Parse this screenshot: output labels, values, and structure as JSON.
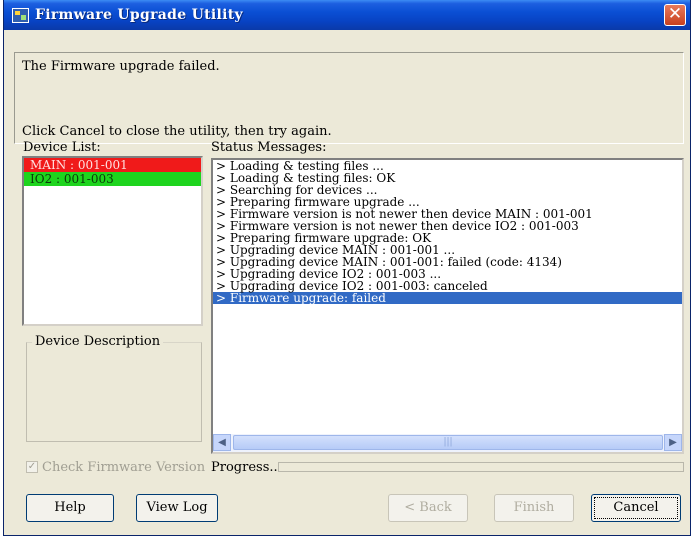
{
  "window": {
    "title": "Firmware Upgrade Utility"
  },
  "message": {
    "line1": "The Firmware upgrade failed.",
    "line2": "Click Cancel to close the utility, then try again."
  },
  "device_list": {
    "label": "Device List:",
    "items": [
      {
        "label": "MAIN : 001-001",
        "status_color": "#f01a1a"
      },
      {
        "label": "IO2 : 001-003",
        "status_color": "#1ed41e"
      }
    ]
  },
  "device_description": {
    "label": "Device Description"
  },
  "status": {
    "label": "Status Messages:",
    "lines": [
      "> Loading & testing files ...",
      "> Loading & testing files: OK",
      "> Searching for devices ...",
      "> Preparing firmware upgrade ...",
      "> Firmware version is not newer then device MAIN : 001-001",
      "> Firmware version is not newer then device IO2 : 001-003",
      "> Preparing firmware upgrade: OK",
      "> Upgrading device MAIN : 001-001 ...",
      "> Upgrading device MAIN : 001-001: failed (code: 4134)",
      "> Upgrading device IO2 : 001-003 ...",
      "> Upgrading device IO2 : 001-003: canceled",
      "> Firmware upgrade: failed"
    ],
    "selected_index": 11
  },
  "check_firmware": {
    "label": "Check Firmware Version",
    "checked": true,
    "enabled": false
  },
  "progress": {
    "label": "Progress...",
    "value": 0
  },
  "buttons": {
    "help": "Help",
    "view_log": "View Log",
    "back": "< Back",
    "finish": "Finish",
    "cancel": "Cancel"
  },
  "colors": {
    "title_bar": "#0a4fd4",
    "selection": "#316ac5"
  }
}
